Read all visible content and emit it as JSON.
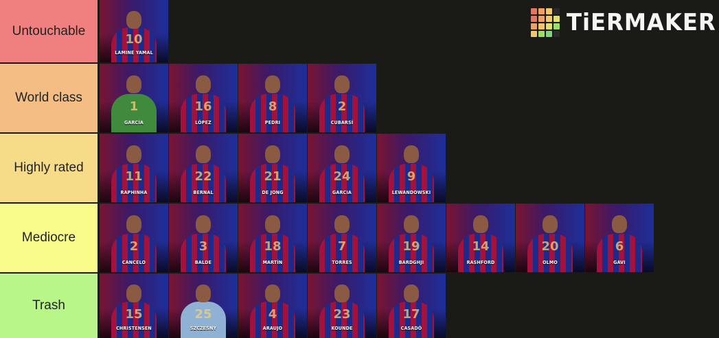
{
  "tiers": [
    {
      "label": "Untouchable",
      "color": "#f08080",
      "players": [
        {
          "name": "LAMINE YAMAL",
          "number": "10",
          "kit": "home"
        }
      ]
    },
    {
      "label": "World class",
      "color": "#f4bd83",
      "players": [
        {
          "name": "GARCÍA",
          "number": "1",
          "kit": "keeper-green"
        },
        {
          "name": "LÓPEZ",
          "number": "16",
          "kit": "home"
        },
        {
          "name": "PEDRI",
          "number": "8",
          "kit": "home"
        },
        {
          "name": "CUBARSÍ",
          "number": "2",
          "kit": "home"
        }
      ]
    },
    {
      "label": "Highly rated",
      "color": "#f6dc89",
      "players": [
        {
          "name": "RAPHINHA",
          "number": "11",
          "kit": "home"
        },
        {
          "name": "BERNAL",
          "number": "22",
          "kit": "home"
        },
        {
          "name": "DE JONG",
          "number": "21",
          "kit": "home"
        },
        {
          "name": "GARCIA",
          "number": "24",
          "kit": "home"
        },
        {
          "name": "LEWANDOWSKI",
          "number": "9",
          "kit": "home"
        }
      ]
    },
    {
      "label": "Mediocre",
      "color": "#f9fb8b",
      "players": [
        {
          "name": "CANCELO",
          "number": "2",
          "kit": "home"
        },
        {
          "name": "BALDE",
          "number": "3",
          "kit": "home"
        },
        {
          "name": "MARTÍN",
          "number": "18",
          "kit": "home"
        },
        {
          "name": "TORRES",
          "number": "7",
          "kit": "home"
        },
        {
          "name": "BARDGHJI",
          "number": "19",
          "kit": "home"
        },
        {
          "name": "RASHFORD",
          "number": "14",
          "kit": "home"
        },
        {
          "name": "OLMO",
          "number": "20",
          "kit": "home"
        },
        {
          "name": "GAVI",
          "number": "6",
          "kit": "home"
        }
      ]
    },
    {
      "label": "Trash",
      "color": "#b9f68a",
      "players": [
        {
          "name": "CHRISTENSEN",
          "number": "15",
          "kit": "home"
        },
        {
          "name": "SZCZESNY",
          "number": "25",
          "kit": "keeper-blue"
        },
        {
          "name": "ARAUJO",
          "number": "4",
          "kit": "home"
        },
        {
          "name": "KOUNDE",
          "number": "23",
          "kit": "home"
        },
        {
          "name": "CASADÓ",
          "number": "17",
          "kit": "home"
        }
      ]
    }
  ],
  "logo": {
    "text": "TiERMAKER",
    "grid_colors": [
      "#e8735f",
      "#f0a063",
      "#f4c667",
      "#2a2a2a",
      "#e8735f",
      "#f0a063",
      "#f4c667",
      "#e0e06a",
      "#f0a063",
      "#f4c667",
      "#e0e06a",
      "#9fdc6a",
      "#f4c667",
      "#9fdc6a",
      "#7ed67a",
      "#2a2a2a"
    ]
  }
}
